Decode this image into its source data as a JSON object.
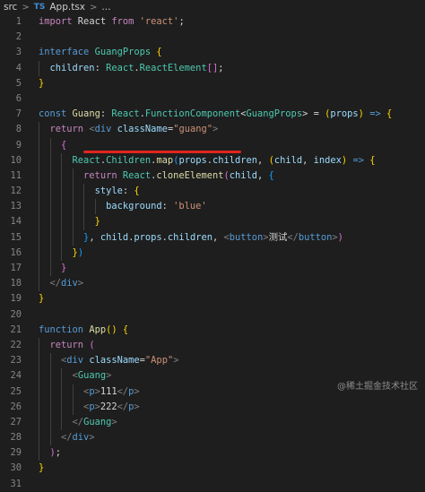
{
  "breadcrumb": {
    "folder": "src",
    "lang_badge": "TS",
    "file": "App.tsx",
    "tail": "..."
  },
  "watermark": "@稀土掘金技术社区",
  "colors": {
    "underline": "#e0261f",
    "background": "#1e1e1e"
  },
  "lines": [
    {
      "n": "1",
      "segs": [
        [
          "kw",
          "import"
        ],
        [
          "",
          " React "
        ],
        [
          "kw",
          "from"
        ],
        [
          "",
          " "
        ],
        [
          "str",
          "'react'"
        ],
        [
          "",
          ";"
        ]
      ]
    },
    {
      "n": "2",
      "segs": []
    },
    {
      "n": "3",
      "segs": [
        [
          "kw2",
          "interface"
        ],
        [
          "",
          " "
        ],
        [
          "ty",
          "GuangProps"
        ],
        [
          "",
          " "
        ],
        [
          "b1",
          "{"
        ]
      ]
    },
    {
      "n": "4",
      "segs": [
        [
          "",
          "  "
        ],
        [
          "var",
          "children"
        ],
        [
          "",
          ": "
        ],
        [
          "ty",
          "React"
        ],
        [
          "",
          "."
        ],
        [
          "ty",
          "ReactElement"
        ],
        [
          "b2",
          "[]"
        ],
        [
          "",
          ";"
        ]
      ]
    },
    {
      "n": "5",
      "segs": [
        [
          "b1",
          "}"
        ]
      ]
    },
    {
      "n": "6",
      "segs": []
    },
    {
      "n": "7",
      "segs": [
        [
          "kw2",
          "const"
        ],
        [
          "",
          " "
        ],
        [
          "fn",
          "Guang"
        ],
        [
          "",
          ": "
        ],
        [
          "ty",
          "React"
        ],
        [
          "",
          "."
        ],
        [
          "ty",
          "FunctionComponent"
        ],
        [
          "",
          "<"
        ],
        [
          "ty",
          "GuangProps"
        ],
        [
          "",
          "> = "
        ],
        [
          "b1",
          "("
        ],
        [
          "var",
          "props"
        ],
        [
          "b1",
          ")"
        ],
        [
          "",
          " "
        ],
        [
          "kw2",
          "=>"
        ],
        [
          "",
          " "
        ],
        [
          "b1",
          "{"
        ]
      ]
    },
    {
      "n": "8",
      "segs": [
        [
          "",
          "  "
        ],
        [
          "kw",
          "return"
        ],
        [
          "",
          " "
        ],
        [
          "ang",
          "<"
        ],
        [
          "tag",
          "div"
        ],
        [
          "",
          " "
        ],
        [
          "var",
          "className"
        ],
        [
          "",
          "="
        ],
        [
          "str",
          "\"guang\""
        ],
        [
          "ang",
          ">"
        ]
      ]
    },
    {
      "n": "9",
      "segs": [
        [
          "",
          "    "
        ],
        [
          "b2",
          "{"
        ]
      ]
    },
    {
      "n": "10",
      "segs": [
        [
          "",
          "      "
        ],
        [
          "ty",
          "React"
        ],
        [
          "",
          "."
        ],
        [
          "ty",
          "Children"
        ],
        [
          "",
          "."
        ],
        [
          "fn",
          "map"
        ],
        [
          "b3",
          "("
        ],
        [
          "var",
          "props"
        ],
        [
          "",
          "."
        ],
        [
          "var",
          "children"
        ],
        [
          "",
          ", "
        ],
        [
          "b1",
          "("
        ],
        [
          "var",
          "child"
        ],
        [
          "",
          ", "
        ],
        [
          "var",
          "index"
        ],
        [
          "b1",
          ")"
        ],
        [
          "",
          " "
        ],
        [
          "kw2",
          "=>"
        ],
        [
          "",
          " "
        ],
        [
          "b1",
          "{"
        ]
      ]
    },
    {
      "n": "11",
      "segs": [
        [
          "",
          "        "
        ],
        [
          "kw",
          "return"
        ],
        [
          "",
          " "
        ],
        [
          "ty",
          "React"
        ],
        [
          "",
          "."
        ],
        [
          "fn",
          "cloneElement"
        ],
        [
          "b2",
          "("
        ],
        [
          "var",
          "child"
        ],
        [
          "",
          ", "
        ],
        [
          "b3",
          "{"
        ]
      ]
    },
    {
      "n": "12",
      "segs": [
        [
          "",
          "          "
        ],
        [
          "var",
          "style"
        ],
        [
          "",
          ": "
        ],
        [
          "b1",
          "{"
        ]
      ]
    },
    {
      "n": "13",
      "segs": [
        [
          "",
          "            "
        ],
        [
          "var",
          "background"
        ],
        [
          "",
          ": "
        ],
        [
          "str",
          "'blue'"
        ]
      ]
    },
    {
      "n": "14",
      "segs": [
        [
          "",
          "          "
        ],
        [
          "b1",
          "}"
        ]
      ]
    },
    {
      "n": "15",
      "segs": [
        [
          "",
          "        "
        ],
        [
          "b3",
          "}"
        ],
        [
          "",
          ", "
        ],
        [
          "var",
          "child"
        ],
        [
          "",
          "."
        ],
        [
          "var",
          "props"
        ],
        [
          "",
          "."
        ],
        [
          "var",
          "children"
        ],
        [
          "",
          ", "
        ],
        [
          "ang",
          "<"
        ],
        [
          "tag",
          "button"
        ],
        [
          "ang",
          ">"
        ],
        [
          "",
          "测试"
        ],
        [
          "ang",
          "</"
        ],
        [
          "tag",
          "button"
        ],
        [
          "ang",
          ">"
        ],
        [
          "b2",
          ")"
        ]
      ]
    },
    {
      "n": "16",
      "segs": [
        [
          "",
          "      "
        ],
        [
          "b1",
          "}"
        ],
        [
          "b3",
          ")"
        ]
      ]
    },
    {
      "n": "17",
      "segs": [
        [
          "",
          "    "
        ],
        [
          "b2",
          "}"
        ]
      ]
    },
    {
      "n": "18",
      "segs": [
        [
          "",
          "  "
        ],
        [
          "ang",
          "</"
        ],
        [
          "tag",
          "div"
        ],
        [
          "ang",
          ">"
        ]
      ]
    },
    {
      "n": "19",
      "segs": [
        [
          "b1",
          "}"
        ]
      ]
    },
    {
      "n": "20",
      "segs": []
    },
    {
      "n": "21",
      "segs": [
        [
          "kw2",
          "function"
        ],
        [
          "",
          " "
        ],
        [
          "fn",
          "App"
        ],
        [
          "b1",
          "()"
        ],
        [
          "",
          " "
        ],
        [
          "b1",
          "{"
        ]
      ]
    },
    {
      "n": "22",
      "segs": [
        [
          "",
          "  "
        ],
        [
          "kw",
          "return"
        ],
        [
          "",
          " "
        ],
        [
          "b2",
          "("
        ]
      ]
    },
    {
      "n": "23",
      "segs": [
        [
          "",
          "    "
        ],
        [
          "ang",
          "<"
        ],
        [
          "tag",
          "div"
        ],
        [
          "",
          " "
        ],
        [
          "var",
          "className"
        ],
        [
          "",
          "="
        ],
        [
          "str",
          "\"App\""
        ],
        [
          "ang",
          ">"
        ]
      ]
    },
    {
      "n": "24",
      "segs": [
        [
          "",
          "      "
        ],
        [
          "ang",
          "<"
        ],
        [
          "ty",
          "Guang"
        ],
        [
          "ang",
          ">"
        ]
      ]
    },
    {
      "n": "25",
      "segs": [
        [
          "",
          "        "
        ],
        [
          "ang",
          "<"
        ],
        [
          "tag",
          "p"
        ],
        [
          "ang",
          ">"
        ],
        [
          "",
          "111"
        ],
        [
          "ang",
          "</"
        ],
        [
          "tag",
          "p"
        ],
        [
          "ang",
          ">"
        ]
      ]
    },
    {
      "n": "26",
      "segs": [
        [
          "",
          "        "
        ],
        [
          "ang",
          "<"
        ],
        [
          "tag",
          "p"
        ],
        [
          "ang",
          ">"
        ],
        [
          "",
          "222"
        ],
        [
          "ang",
          "</"
        ],
        [
          "tag",
          "p"
        ],
        [
          "ang",
          ">"
        ]
      ]
    },
    {
      "n": "27",
      "segs": [
        [
          "",
          "      "
        ],
        [
          "ang",
          "</"
        ],
        [
          "ty",
          "Guang"
        ],
        [
          "ang",
          ">"
        ]
      ]
    },
    {
      "n": "28",
      "segs": [
        [
          "",
          "    "
        ],
        [
          "ang",
          "</"
        ],
        [
          "tag",
          "div"
        ],
        [
          "ang",
          ">"
        ]
      ]
    },
    {
      "n": "29",
      "segs": [
        [
          "",
          "  "
        ],
        [
          "b2",
          ")"
        ],
        [
          "",
          ";"
        ]
      ]
    },
    {
      "n": "30",
      "segs": [
        [
          "b1",
          "}"
        ]
      ]
    },
    {
      "n": "31",
      "segs": []
    }
  ]
}
